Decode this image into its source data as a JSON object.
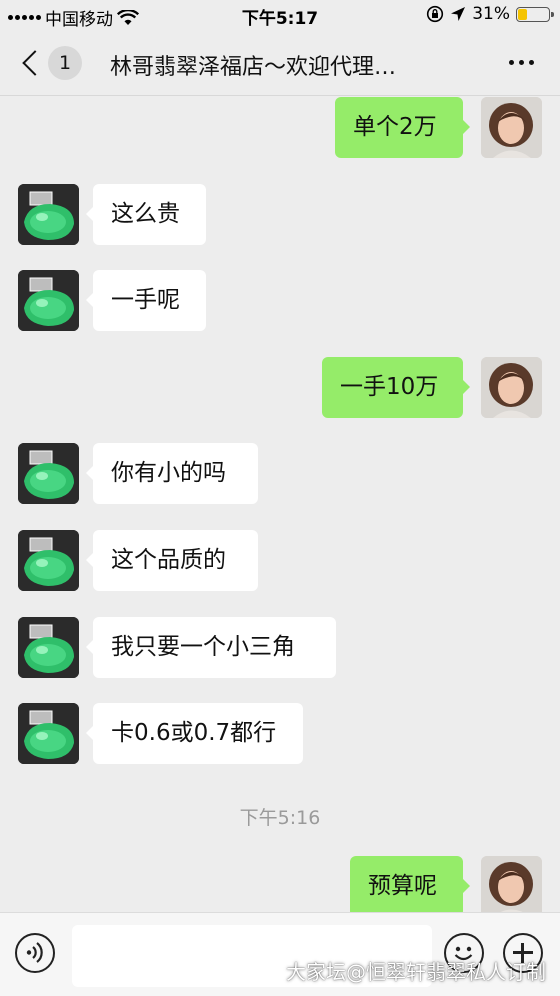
{
  "status_bar": {
    "carrier": "中国移动",
    "time": "下午5:17",
    "battery": "31%",
    "battery_level": 0.31,
    "battery_color": "#f5c400"
  },
  "nav": {
    "back_icon": "chevron-left-icon",
    "unread_count": "1",
    "title": "林哥翡翠泽福店～欢迎代理…",
    "more_icon": "more-dots-icon"
  },
  "messages": [
    {
      "side": "right",
      "text": "单个2万"
    },
    {
      "side": "left",
      "text": "这么贵"
    },
    {
      "side": "left",
      "text": "一手呢"
    },
    {
      "side": "right",
      "text": "一手10万"
    },
    {
      "side": "left",
      "text": "你有小的吗"
    },
    {
      "side": "left",
      "text": "这个品质的"
    },
    {
      "side": "left",
      "text": "我只要一个小三角"
    },
    {
      "side": "left",
      "text": "卡0.6或0.7都行"
    },
    {
      "side": "right",
      "text": "预算呢"
    }
  ],
  "timestamp": "下午5:16",
  "input_bar": {
    "voice_icon": "voice-icon",
    "input_value": "",
    "emoji_icon": "emoji-icon",
    "plus_icon": "plus-icon"
  },
  "colors": {
    "own_bubble": "#95ec69",
    "other_bubble": "#ffffff",
    "background": "#ededed"
  },
  "watermark": "大家坛@恒翠轩翡翠私人订制"
}
